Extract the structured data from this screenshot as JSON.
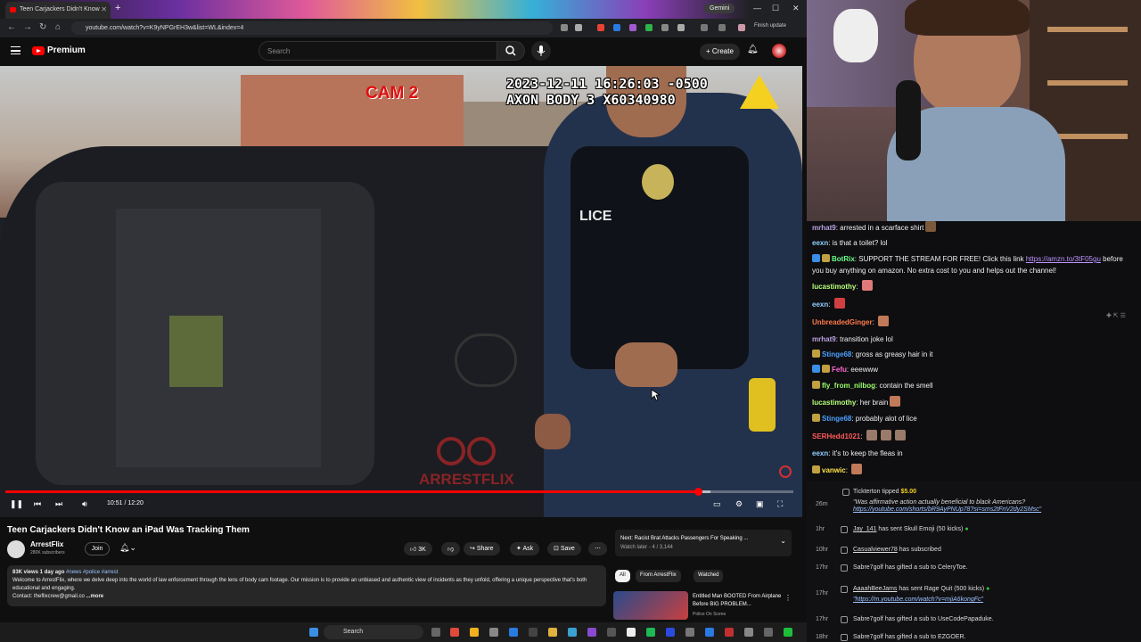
{
  "browser": {
    "tab_title": "Teen Carjackers Didn't Know",
    "gemini_label": "Gemini",
    "url": "youtube.com/watch?v=K9yNPGrEH3w&list=WL&index=4",
    "finish_update": "Finish update"
  },
  "youtube": {
    "premium_label": "Premium",
    "search_placeholder": "Search",
    "create_label": "Create"
  },
  "video": {
    "timestamp_line1": "2023-12-11 16:26:03 -0500",
    "timestamp_line2": "AXON BODY 3 X60340980",
    "cam_label": "CAM 2",
    "watermark": "ARRESTFLIX",
    "vest_text": "LICE",
    "current_time": "10:51",
    "duration": "12:20",
    "progress": 0.8795,
    "loaded": 0.895
  },
  "below": {
    "title": "Teen Carjackers Didn't Know an iPad Was Tracking Them",
    "channel_name": "ArrestFlix",
    "channel_subs": "280K subscribers",
    "join_label": "Join",
    "likes": "3K",
    "share_label": "Share",
    "ask_label": "Ask",
    "save_label": "Save",
    "stats": "83K views  1 day ago",
    "hashtags": "#news #police #arrest",
    "description": "Welcome to ArrestFlix, where we delve deep into the world of law enforcement through the lens of body cam footage. Our mission is to provide an unbiased and authentic view of incidents as they unfold, offering a unique perspective that's both educational and engaging.",
    "contact": "Contact: theflixcrew@gmail.co",
    "more": "...more",
    "next_label": "Next: Racist Brat Attacks Passengers For Speaking ...",
    "watch_later": "Watch later - 4 / 3,144",
    "chips": [
      "All",
      "From ArrestFlix",
      "Watched"
    ],
    "rec_title": "Entitled Man BOOTED From Airplane Before BIG PROBLEM...",
    "rec_channel": "Police On Scene"
  },
  "taskbar": {
    "search_label": "Search"
  },
  "chat": {
    "messages": [
      {
        "name": "mrhat9",
        "color": "#b9a3e3",
        "text": "arrested in a scarface shirt"
      },
      {
        "name": "eexn",
        "color": "#8fd0ff",
        "text": "is that a toilet? lol"
      },
      {
        "name": "BotRix",
        "color": "#6bff8a",
        "text": "SUPPORT THE STREAM FOR FREE! Click this link",
        "link": "https://amzn.to/3tF05gu",
        "cont": "before you buy anything on amazon. No extra cost to you and helps out the channel!"
      },
      {
        "name": "lucastimothy",
        "color": "#b7ff7a",
        "text": ""
      },
      {
        "name": "eexn",
        "color": "#8fd0ff",
        "text": ""
      },
      {
        "name": "UnbreadedGinger",
        "color": "#ff7a4a",
        "text": ""
      },
      {
        "name": "mrhat9",
        "color": "#b9a3e3",
        "text": "transition joke lol"
      },
      {
        "name": "Stinge68",
        "color": "#4aa0ff",
        "text": "gross as greasy hair in it"
      },
      {
        "name": "Fefu",
        "color": "#ff6ad5",
        "text": "eeewww"
      },
      {
        "name": "fly_from_nilbog",
        "color": "#9bff6a",
        "text": "contain the smell"
      },
      {
        "name": "lucastimothy",
        "color": "#b7ff7a",
        "text": "her brain"
      },
      {
        "name": "Stinge68",
        "color": "#4aa0ff",
        "text": "probably alot of lice"
      },
      {
        "name": "SERHedd1021",
        "color": "#ff5a5a",
        "text": ""
      },
      {
        "name": "eexn",
        "color": "#8fd0ff",
        "text": "it's to keep the fleas in"
      },
      {
        "name": "vanwic",
        "color": "#ffe14a",
        "text": ""
      }
    ]
  },
  "events": [
    {
      "when": "26m",
      "user": "Tickterton",
      "action": "tipped",
      "amount": "$5.00",
      "quote": "\"Was affirmative action actually beneficial to black Americans?",
      "qlink": "https://youtube.com/shorts/bR9AyPNUp78?si=sms2tFnV2dy2SMsc\""
    },
    {
      "when": "1hr",
      "user": "Jay_141",
      "action": "has sent",
      "item": "Skull Emoji (50 kicks)"
    },
    {
      "when": "10hr",
      "user": "Casualviewer78",
      "action": "has subscribed"
    },
    {
      "when": "17hr",
      "user": "Sabre7golf",
      "action": "has gifted a sub to",
      "target": "CeleryToe."
    },
    {
      "when": "17hr",
      "user": "AaaahBeeJams",
      "action": "has sent",
      "item": "Rage Quit (500 kicks)",
      "qlink": "\"https://m.youtube.com/watch?v=mjiA6kongFc\""
    },
    {
      "when": "17hr",
      "user": "Sabre7golf",
      "action": "has gifted a sub to",
      "target": "UseCodePapaduke."
    },
    {
      "when": "18hr",
      "user": "Sabre7golf",
      "action": "has gifted a sub to",
      "target": "EZGOER."
    }
  ]
}
